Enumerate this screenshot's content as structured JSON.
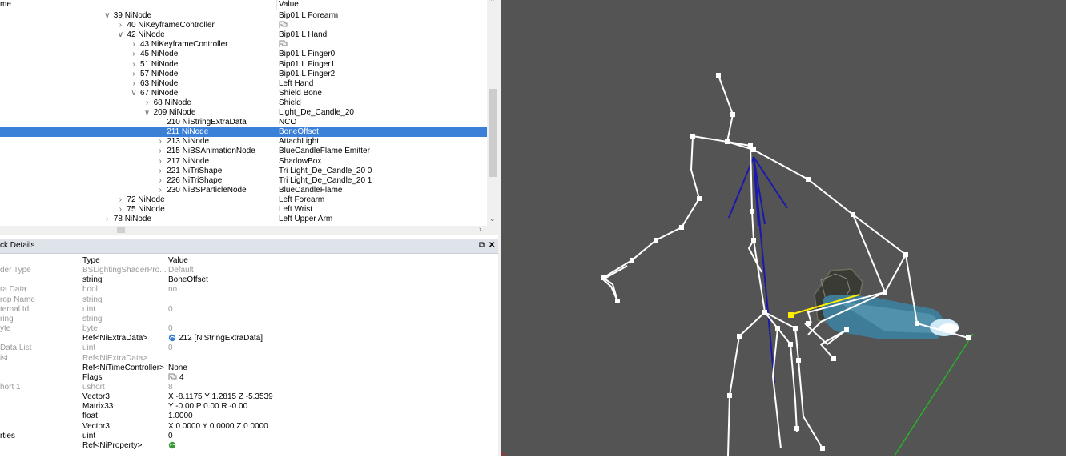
{
  "tree": {
    "header": {
      "name": "me",
      "value": "Value"
    },
    "rows": [
      {
        "depth": 8,
        "expander": "expanded",
        "name": "39 NiNode",
        "value": "Bip01 L Forearm"
      },
      {
        "depth": 9,
        "expander": "collapsed",
        "name": "40 NiKeyframeController",
        "value": "",
        "value_icon": "flags-icon"
      },
      {
        "depth": 9,
        "expander": "expanded",
        "name": "42 NiNode",
        "value": "Bip01 L Hand"
      },
      {
        "depth": 10,
        "expander": "collapsed",
        "name": "43 NiKeyframeController",
        "value": "",
        "value_icon": "flags-icon"
      },
      {
        "depth": 10,
        "expander": "collapsed",
        "name": "45 NiNode",
        "value": "Bip01 L Finger0"
      },
      {
        "depth": 10,
        "expander": "collapsed",
        "name": "51 NiNode",
        "value": "Bip01 L Finger1"
      },
      {
        "depth": 10,
        "expander": "collapsed",
        "name": "57 NiNode",
        "value": "Bip01 L Finger2"
      },
      {
        "depth": 10,
        "expander": "collapsed",
        "name": "63 NiNode",
        "value": "Left Hand"
      },
      {
        "depth": 10,
        "expander": "expanded",
        "name": "67 NiNode",
        "value": "Shield Bone"
      },
      {
        "depth": 11,
        "expander": "collapsed",
        "name": "68 NiNode",
        "value": "Shield"
      },
      {
        "depth": 11,
        "expander": "expanded",
        "name": "209 NiNode",
        "value": "Light_De_Candle_20"
      },
      {
        "depth": 12,
        "expander": "none",
        "name": "210 NiStringExtraData",
        "value": "NCO"
      },
      {
        "depth": 12,
        "expander": "collapsed",
        "name": "211 NiNode",
        "value": "BoneOffset",
        "selected": true
      },
      {
        "depth": 12,
        "expander": "collapsed",
        "name": "213 NiNode",
        "value": "AttachLight"
      },
      {
        "depth": 12,
        "expander": "collapsed",
        "name": "215 NiBSAnimationNode",
        "value": "BlueCandleFlame Emitter"
      },
      {
        "depth": 12,
        "expander": "collapsed",
        "name": "217 NiNode",
        "value": "ShadowBox"
      },
      {
        "depth": 12,
        "expander": "collapsed",
        "name": "221 NiTriShape",
        "value": "Tri Light_De_Candle_20 0"
      },
      {
        "depth": 12,
        "expander": "collapsed",
        "name": "226 NiTriShape",
        "value": "Tri Light_De_Candle_20 1"
      },
      {
        "depth": 12,
        "expander": "collapsed",
        "name": "230 NiBSParticleNode",
        "value": "BlueCandleFlame"
      },
      {
        "depth": 9,
        "expander": "collapsed",
        "name": "72 NiNode",
        "value": "Left Forearm"
      },
      {
        "depth": 9,
        "expander": "collapsed",
        "name": "75 NiNode",
        "value": "Left Wrist"
      },
      {
        "depth": 8,
        "expander": "collapsed",
        "name": "78 NiNode",
        "value": "Left Upper Arm"
      }
    ]
  },
  "details": {
    "title": "ck Details",
    "float_icon": "float-icon",
    "close_icon": "close-icon",
    "header": {
      "name": "",
      "type": "Type",
      "value": "Value"
    },
    "rows": [
      {
        "name": "der Type",
        "type": "BSLightingShaderPro...",
        "value": "Default",
        "dim": true
      },
      {
        "name": "",
        "type": "string",
        "value": "BoneOffset",
        "dim": false
      },
      {
        "name": "ra Data",
        "type": "bool",
        "value": "no",
        "dim": true
      },
      {
        "name": "rop Name",
        "type": "string",
        "value": "",
        "dim": true
      },
      {
        "name": "ternal Id",
        "type": "uint",
        "value": "0",
        "dim": true
      },
      {
        "name": "ring",
        "type": "string",
        "value": "",
        "dim": true
      },
      {
        "name": "yte",
        "type": "byte",
        "value": "0",
        "dim": true
      },
      {
        "name": "",
        "type": "Ref<NiExtraData>",
        "value": "212 [NiStringExtraData]",
        "dim": false,
        "value_icon": "link-icon"
      },
      {
        "name": "Data List",
        "type": "uint",
        "value": "0",
        "dim": true
      },
      {
        "name": "ist",
        "type": "Ref<NiExtraData>",
        "value": "",
        "dim": true
      },
      {
        "name": "",
        "type": "Ref<NiTimeController>",
        "value": "None",
        "dim": false
      },
      {
        "name": "",
        "type": "Flags",
        "value": "4",
        "dim": false,
        "value_icon": "flags-icon"
      },
      {
        "name": "hort 1",
        "type": "ushort",
        "value": "8",
        "dim": true
      },
      {
        "name": "",
        "type": "Vector3",
        "value": "X -8.1175 Y 1.2815 Z -5.3539",
        "dim": false
      },
      {
        "name": "",
        "type": "Matrix33",
        "value": "Y -0.00 P 0.00 R -0.00",
        "dim": false
      },
      {
        "name": "",
        "type": "float",
        "value": "1.0000",
        "dim": false
      },
      {
        "name": "",
        "type": "Vector3",
        "value": "X 0.0000 Y 0.0000 Z 0.0000",
        "dim": false
      },
      {
        "name": "rties",
        "type": "uint",
        "value": "0",
        "dim": false
      },
      {
        "name": "",
        "type": "Ref<NiProperty>",
        "value": "",
        "dim": false,
        "value_icon": "green-link-icon"
      }
    ]
  },
  "viewport": {
    "background": "#545454",
    "bone_color": "#ffffff",
    "selected_axis_color": "#1a1aaa",
    "highlight_color": "#ffee00",
    "ground_axis_color": "#22bb22"
  }
}
